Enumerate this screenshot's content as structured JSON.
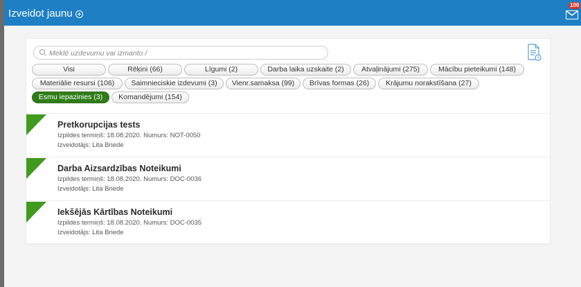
{
  "header": {
    "create_label": "Izveidot jaunu",
    "mail_badge": "100",
    "colors": {
      "bar": "#1e7fc4",
      "badge": "#d9342b"
    }
  },
  "search": {
    "placeholder": "Meklē uzdevumu vai izmanto /"
  },
  "filters": {
    "rows": [
      [
        {
          "label": "Visi"
        },
        {
          "label": "Rēķini (66)"
        },
        {
          "label": "Līgumi (2)"
        },
        {
          "label": "Darba laika uzskaite (2)"
        },
        {
          "label": "Atvaļinājumi (275)"
        },
        {
          "label": "Mācību pieteikumi (148)"
        }
      ],
      [
        {
          "label": "Materiālie resursi (106)"
        },
        {
          "label": "Saimnieciskie izdevumi (3)"
        },
        {
          "label": "Vienr.samaksa (99)"
        },
        {
          "label": "Brīvas formas (26)"
        },
        {
          "label": "Krājumu norakstīšana (27)"
        }
      ],
      [
        {
          "label": "Esmu iepazinies (3)"
        },
        {
          "label": "Komandējumi (154)"
        }
      ]
    ],
    "active": "Esmu iepazinies (3)",
    "active_color": "#2f7d1a"
  },
  "tasks": [
    {
      "title": "Pretkorupcijas tests",
      "meta": "Izpildes termiņš: 18.08.2020. Numurs: NOT-0050",
      "author": "Izveidotājs: Lita Briede"
    },
    {
      "title": "Darba Aizsardzības Noteikumi",
      "meta": "Izpildes termiņš: 18.08.2020. Numurs: DOC-0036",
      "author": "Izveidotājs: Lita Briede"
    },
    {
      "title": "Iekšējās Kārtības Noteikumi",
      "meta": "Izpildes termiņš: 18.08.2020. Numurs: DOC-0035",
      "author": "Izveidotājs: Lita Briede"
    }
  ],
  "flag_color": "#3f9a1e"
}
